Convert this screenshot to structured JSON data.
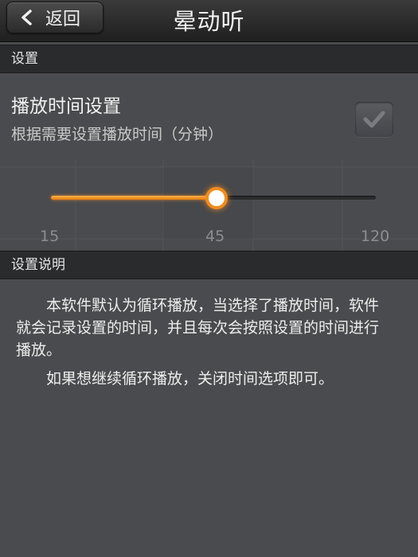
{
  "titlebar": {
    "back_label": "返回",
    "back_icon": "chevron-left-icon",
    "title": "晕动听"
  },
  "sections": {
    "settings_header": "设置",
    "description_header": "设置说明"
  },
  "play_time_setting": {
    "title": "播放时间设置",
    "subtitle": "根据需要设置播放时间（分钟）",
    "checked": true
  },
  "slider": {
    "min": 15,
    "max": 120,
    "value": 45,
    "tick_labels": [
      "15",
      "45",
      "120"
    ],
    "accent_color": "#f08c1e"
  },
  "description": {
    "paragraphs": [
      "本软件默认为循环播放，当选择了播放时间，软件就会记录设置的时间，并且每次会按照设置的时间进行播放。",
      "如果想继续循环播放，关闭时间选项即可。"
    ]
  }
}
